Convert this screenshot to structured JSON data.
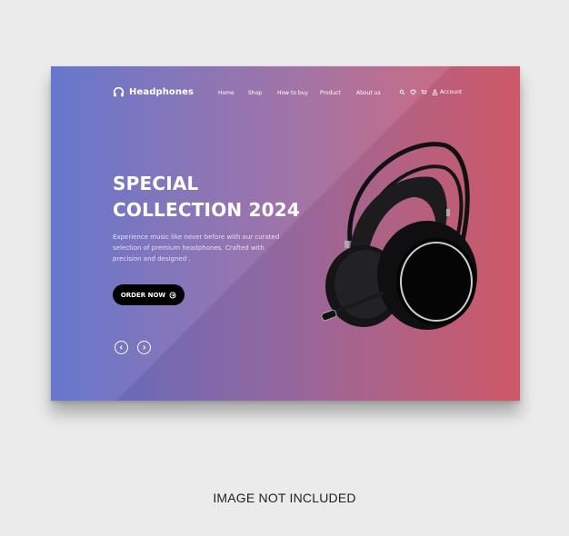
{
  "header": {
    "logo_text": "Headphones",
    "logo_icon": "headphones-icon",
    "nav": [
      {
        "label": "Home"
      },
      {
        "label": "Shop"
      },
      {
        "label": "How to buy"
      },
      {
        "label": "Product"
      },
      {
        "label": "About us"
      }
    ],
    "icons": [
      "search-icon",
      "heart-icon",
      "cart-icon",
      "user-icon"
    ],
    "account_label": "Account"
  },
  "hero": {
    "title_line1": "SPECIAL",
    "title_line2": "COLLECTION 2024",
    "description": "Experience music like never before with our curated selection of premium headphones. Crafted with precision and designed .",
    "cta_label": "ORDER NOW",
    "cta_icon": "arrow-circle-right-icon",
    "prev_icon": "chevron-left-icon",
    "next_icon": "chevron-right-icon"
  },
  "colors": {
    "gradient_start": "#5a6dc9",
    "gradient_end": "#d45b6b",
    "cta_background": "#000000",
    "page_background": "#ebebeb"
  },
  "footer_note": "IMAGE NOT INCLUDED"
}
